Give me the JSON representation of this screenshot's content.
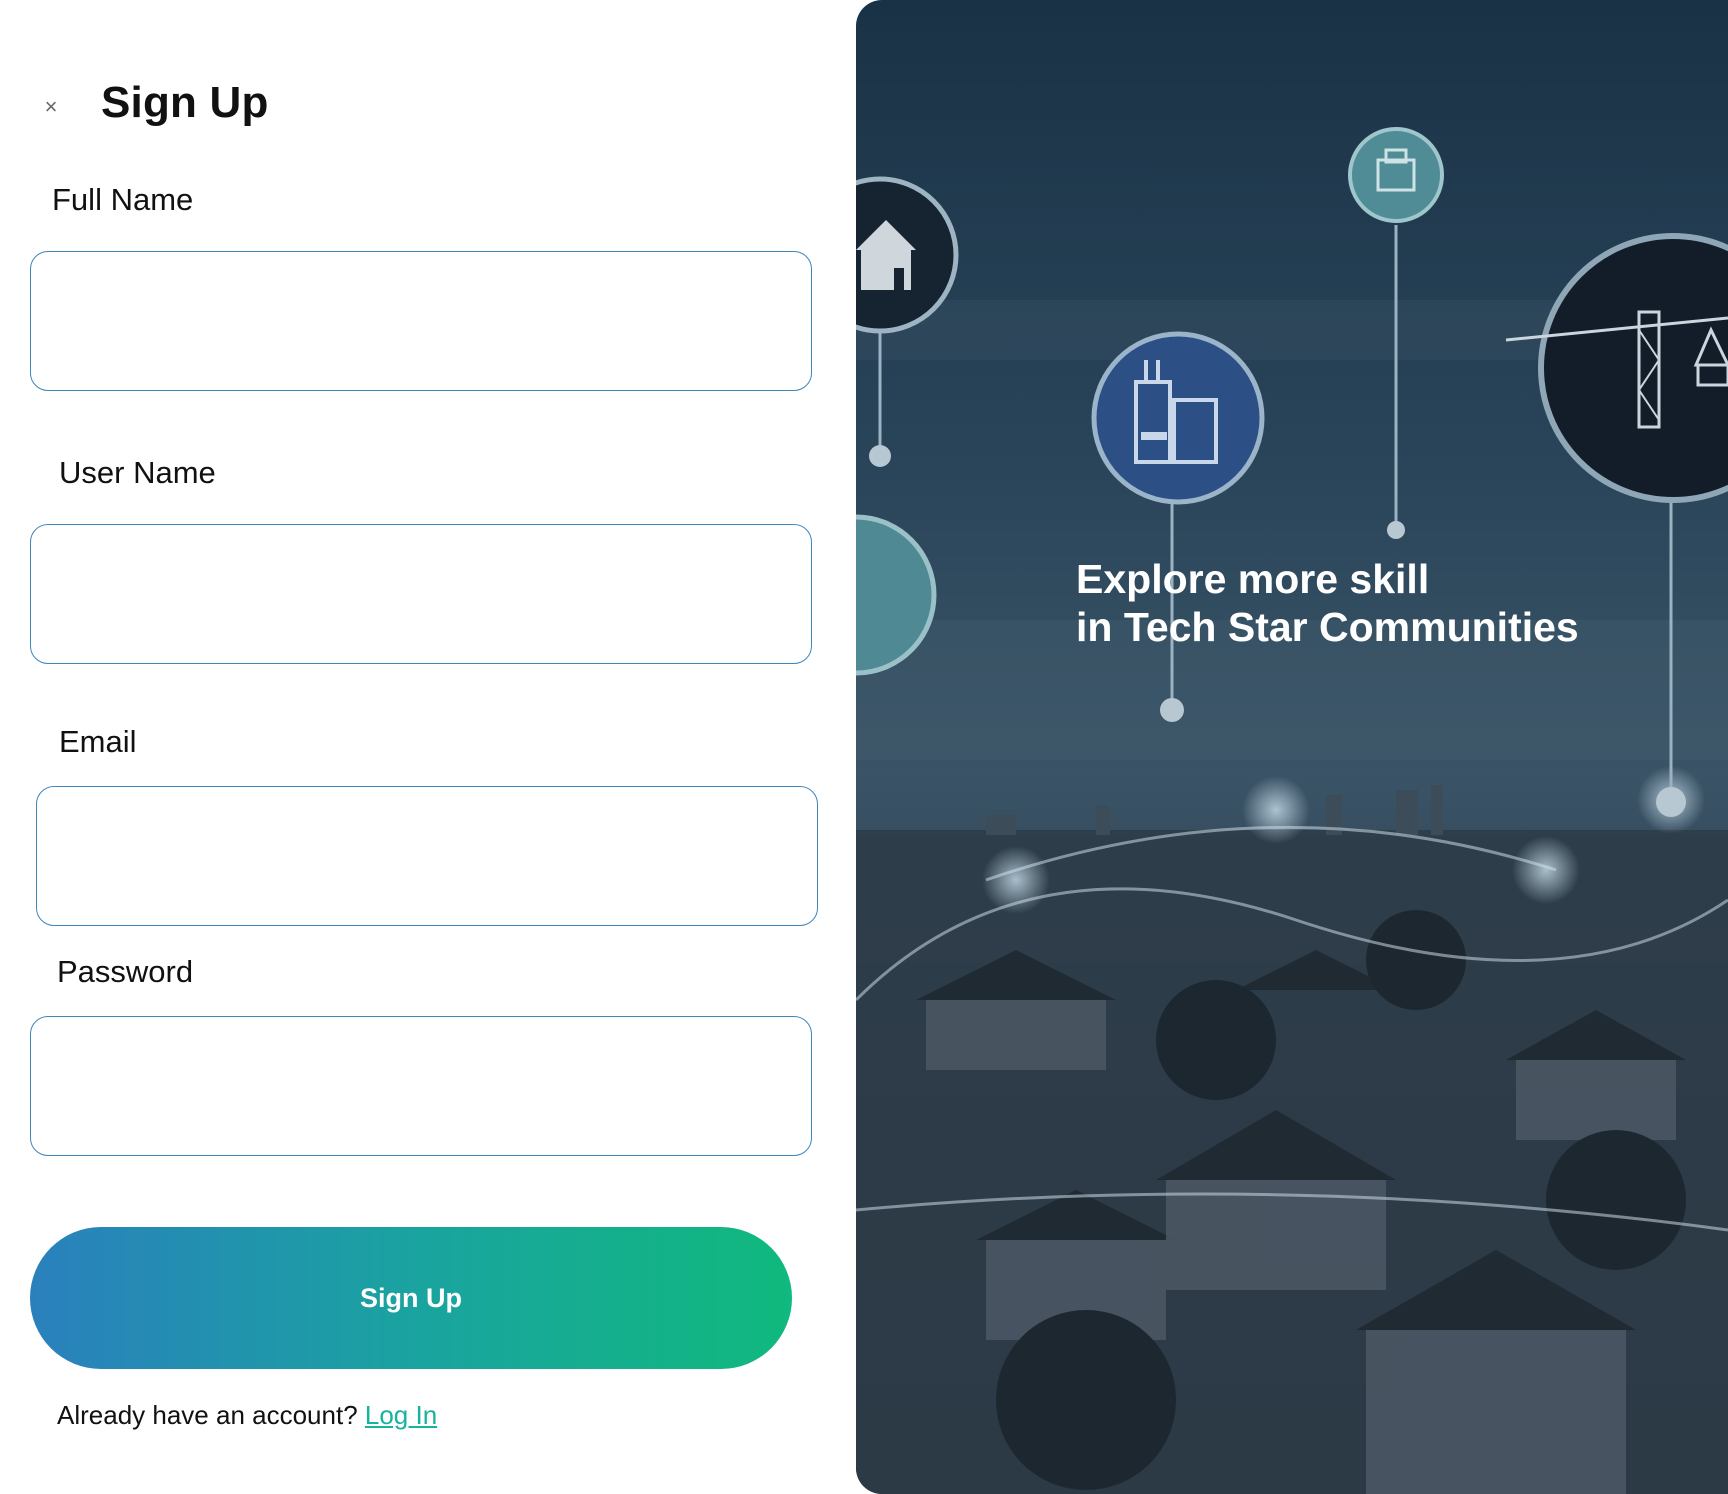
{
  "form": {
    "close_glyph": "×",
    "title": "Sign Up",
    "fields": [
      {
        "label": "Full Name",
        "value": "",
        "placeholder": ""
      },
      {
        "label": "User Name",
        "value": "",
        "placeholder": ""
      },
      {
        "label": "Email",
        "value": "",
        "placeholder": ""
      },
      {
        "label": "Password",
        "value": "",
        "placeholder": ""
      }
    ],
    "submit_label": "Sign Up",
    "footer_text": "Already have an account? ",
    "login_link": "Log In"
  },
  "hero": {
    "line1": "Explore more skill",
    "line2": "in Tech Star Communities"
  },
  "colors": {
    "field_border": "#3f86ba",
    "button_gradient_start": "#2a80bd",
    "button_gradient_end": "#10b97d",
    "link": "#17b39e",
    "hero_overlay": "#1a3246"
  },
  "icons": [
    "close-icon",
    "house-icon",
    "office-building-icon",
    "factory-icon",
    "crane-icon"
  ]
}
